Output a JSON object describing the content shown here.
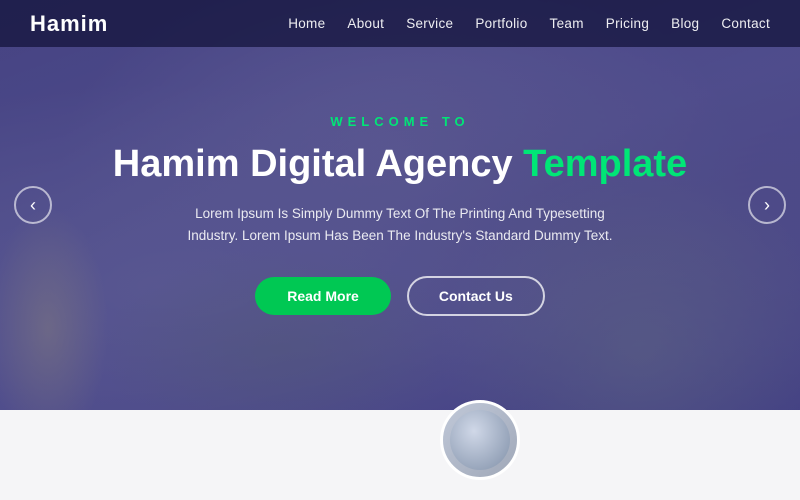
{
  "navbar": {
    "logo": "Hamim",
    "links": [
      {
        "label": "Home",
        "id": "home"
      },
      {
        "label": "About",
        "id": "about"
      },
      {
        "label": "Service",
        "id": "service"
      },
      {
        "label": "Portfolio",
        "id": "portfolio"
      },
      {
        "label": "Team",
        "id": "team"
      },
      {
        "label": "Pricing",
        "id": "pricing"
      },
      {
        "label": "Blog",
        "id": "blog"
      },
      {
        "label": "Contact",
        "id": "contact"
      }
    ]
  },
  "hero": {
    "welcome": "WELCOME TO",
    "title_part1": "Hamim Digital Agency",
    "title_accent": "Template",
    "subtitle": "Lorem Ipsum Is Simply Dummy Text Of The Printing And Typesetting Industry. Lorem Ipsum Has Been The Industry's Standard Dummy Text.",
    "btn_read_more": "Read More",
    "btn_contact": "Contact Us",
    "arrow_left": "‹",
    "arrow_right": "›"
  },
  "colors": {
    "accent": "#00e676",
    "btn_green": "#00c853",
    "overlay": "rgba(60,50,120,0.72)"
  }
}
